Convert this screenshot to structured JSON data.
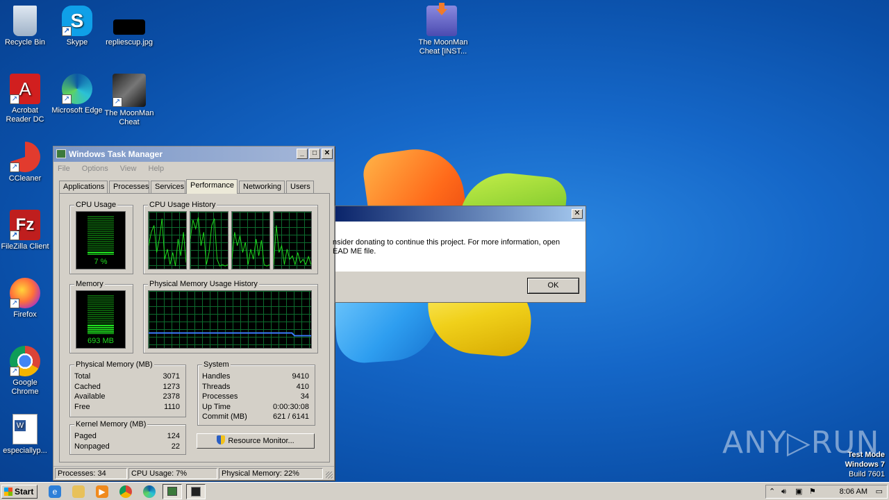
{
  "desktop": {
    "icons": [
      {
        "label": "Recycle Bin",
        "icon": "recycle-bin-icon"
      },
      {
        "label": "Skype",
        "icon": "skype-icon"
      },
      {
        "label": "repliescup.jpg",
        "icon": "image-file-icon"
      },
      {
        "label": "Acrobat Reader DC",
        "icon": "acrobat-icon"
      },
      {
        "label": "Microsoft Edge",
        "icon": "edge-icon"
      },
      {
        "label": "The MoonMan Cheat",
        "icon": "moonman-icon"
      },
      {
        "label": "CCleaner",
        "icon": "ccleaner-icon"
      },
      {
        "label": "FileZilla Client",
        "icon": "filezilla-icon"
      },
      {
        "label": "Firefox",
        "icon": "firefox-icon"
      },
      {
        "label": "Google Chrome",
        "icon": "chrome-icon"
      },
      {
        "label": "especiallyp...",
        "icon": "word-doc-icon"
      },
      {
        "label": "The MoonMan Cheat [INST...",
        "icon": "installer-icon"
      }
    ]
  },
  "task_manager": {
    "title": "Windows Task Manager",
    "menu": [
      "File",
      "Options",
      "View",
      "Help"
    ],
    "tabs": [
      "Applications",
      "Processes",
      "Services",
      "Performance",
      "Networking",
      "Users"
    ],
    "active_tab": "Performance",
    "cpu_usage": {
      "label": "CPU Usage",
      "value_text": "7 %",
      "level_percent": 7
    },
    "cpu_history": {
      "label": "CPU Usage History"
    },
    "memory": {
      "label": "Memory",
      "value_text": "693 MB",
      "level_percent": 22
    },
    "memory_history": {
      "label": "Physical Memory Usage History"
    },
    "physical_memory": {
      "label": "Physical Memory (MB)",
      "rows": [
        {
          "k": "Total",
          "v": "3071"
        },
        {
          "k": "Cached",
          "v": "1273"
        },
        {
          "k": "Available",
          "v": "2378"
        },
        {
          "k": "Free",
          "v": "1110"
        }
      ]
    },
    "kernel_memory": {
      "label": "Kernel Memory (MB)",
      "rows": [
        {
          "k": "Paged",
          "v": "124"
        },
        {
          "k": "Nonpaged",
          "v": "22"
        }
      ]
    },
    "system": {
      "label": "System",
      "rows": [
        {
          "k": "Handles",
          "v": "9410"
        },
        {
          "k": "Threads",
          "v": "410"
        },
        {
          "k": "Processes",
          "v": "34"
        },
        {
          "k": "Up Time",
          "v": "0:00:30:08"
        },
        {
          "k": "Commit (MB)",
          "v": "621 / 6141"
        }
      ]
    },
    "resource_monitor_button": "Resource Monitor...",
    "status": {
      "processes": "Processes: 34",
      "cpu": "CPU Usage: 7%",
      "memory": "Physical Memory: 22%"
    }
  },
  "dialog": {
    "message_line1": "nsider donating to continue this project. For more information, open",
    "message_line2": "EAD ME file.",
    "ok_label": "OK",
    "close_glyph": "✕"
  },
  "taskbar": {
    "start_label": "Start",
    "clock": "8:06 AM"
  },
  "watermark": {
    "brand": "ANY▷RUN",
    "test_mode": "Test Mode",
    "os": "Windows 7",
    "build": "Build 7601"
  }
}
